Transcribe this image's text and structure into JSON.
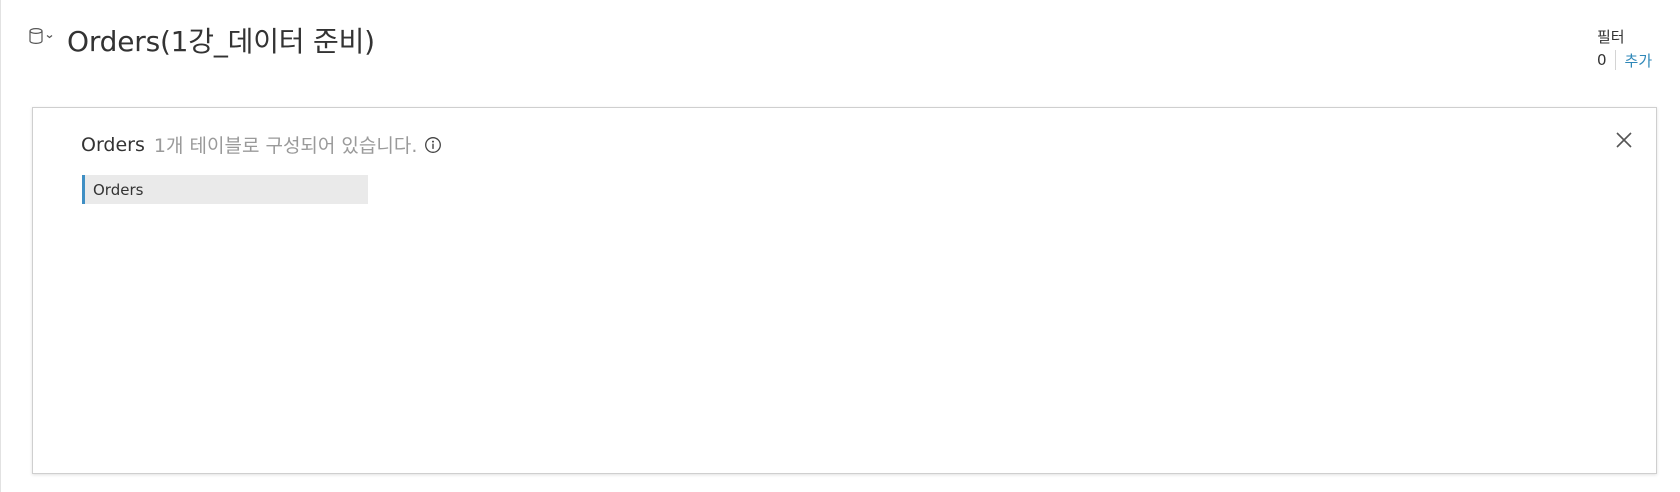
{
  "header": {
    "datasource_icon": "database-icon",
    "dropdown_icon": "chevron-down-icon",
    "title": "Orders(1강_데이터 준비)"
  },
  "filters": {
    "label": "필터",
    "count": "0",
    "add_label": "추가"
  },
  "panel": {
    "table_name": "Orders",
    "description": "1개 테이블로 구성되어 있습니다.",
    "info_icon": "info-icon",
    "close_icon": "close-icon",
    "tables": [
      {
        "label": "Orders"
      }
    ]
  },
  "colors": {
    "accent": "#3f8fc4",
    "link": "#2e87b8",
    "muted_text": "#9a9a9a",
    "table_item_bg": "#eaeaea"
  }
}
